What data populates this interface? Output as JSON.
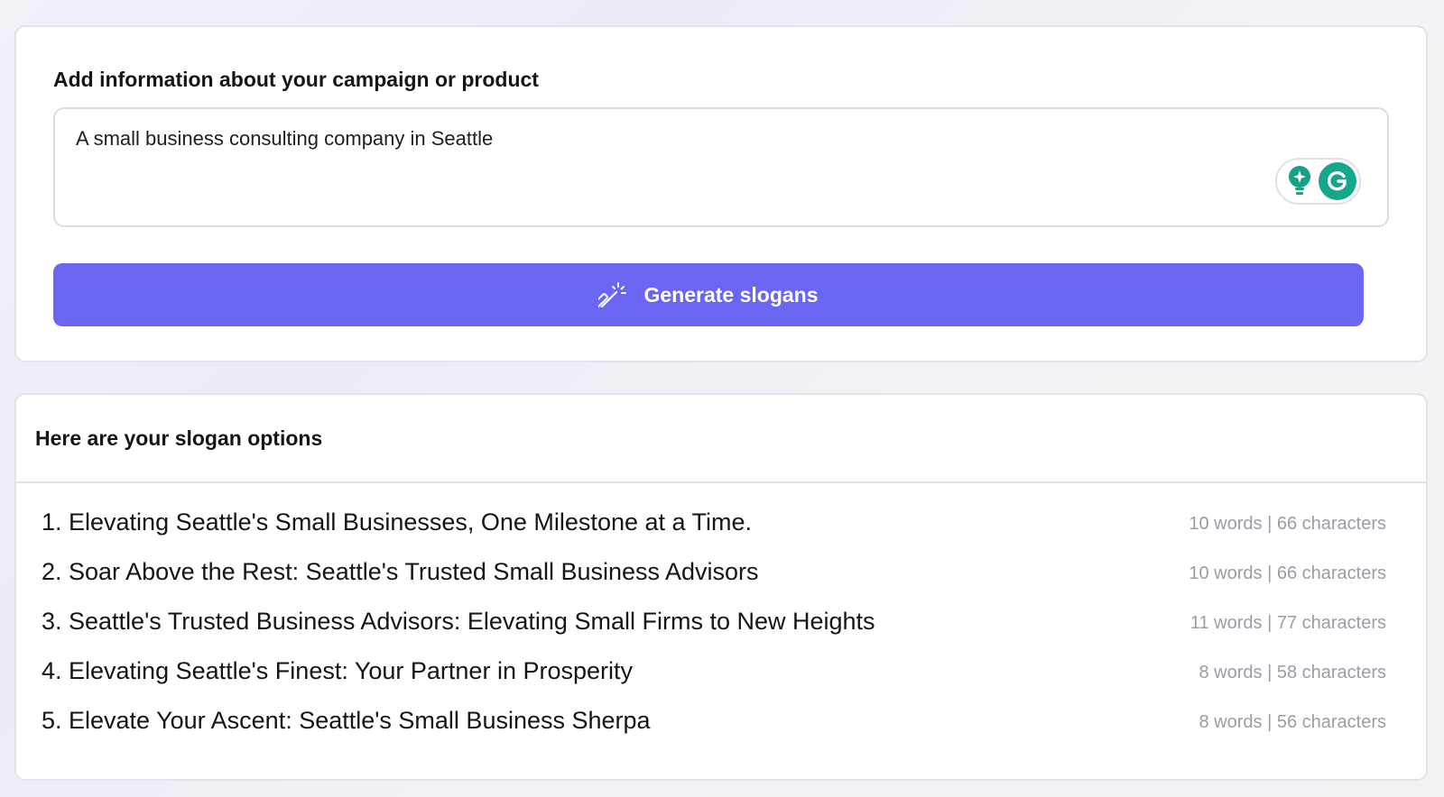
{
  "input_card": {
    "label": "Add information about your campaign or product",
    "textarea_value": "A small business consulting company in Seattle",
    "generate_button_label": "Generate slogans",
    "accent_color": "#6b66f2"
  },
  "results_card": {
    "title": "Here are your slogan options",
    "slogans": [
      {
        "text": "1. Elevating Seattle's Small Businesses, One Milestone at a Time.",
        "meta": "10 words | 66 characters"
      },
      {
        "text": "2. Soar Above the Rest: Seattle's Trusted Small Business Advisors",
        "meta": "10 words | 66 characters"
      },
      {
        "text": "3. Seattle's Trusted Business Advisors: Elevating Small Firms to New Heights",
        "meta": "11 words | 77 characters"
      },
      {
        "text": "4. Elevating Seattle's Finest: Your Partner in Prosperity",
        "meta": "8 words | 58 characters"
      },
      {
        "text": "5. Elevate Your Ascent: Seattle's Small Business Sherpa",
        "meta": "8 words | 56 characters"
      }
    ]
  },
  "icons": {
    "assist_bulb": "lightbulb-sparkle-icon",
    "grammarly": "grammarly-g-icon",
    "generate": "magic-wand-icon"
  }
}
